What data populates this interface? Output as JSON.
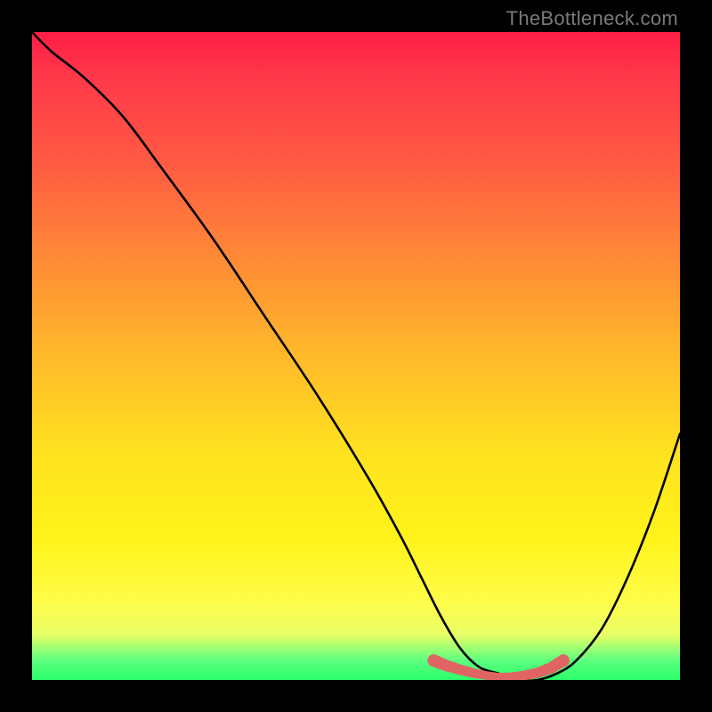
{
  "watermark": "TheBottleneck.com",
  "chart_data": {
    "type": "line",
    "title": "",
    "xlabel": "",
    "ylabel": "",
    "x_range": [
      0,
      100
    ],
    "y_range": [
      0,
      100
    ],
    "series": [
      {
        "name": "bottleneck-curve",
        "color": "#000000",
        "x": [
          0,
          3,
          8,
          14,
          20,
          28,
          36,
          44,
          52,
          57,
          60,
          63,
          66,
          69,
          72,
          75,
          78,
          81,
          84,
          88,
          92,
          96,
          100
        ],
        "values": [
          100,
          97,
          93,
          87,
          79,
          68,
          56,
          44,
          31,
          22,
          16,
          10,
          5,
          2,
          1,
          0,
          0,
          1,
          3,
          8,
          16,
          26,
          38
        ]
      },
      {
        "name": "valley-highlight",
        "color": "#e16464",
        "style": "dotted-thick",
        "x": [
          62,
          64,
          66,
          68,
          70,
          72,
          74,
          76,
          78,
          80,
          82
        ],
        "values": [
          3,
          2.2,
          1.6,
          1.1,
          0.7,
          0.5,
          0.5,
          0.7,
          1.1,
          1.8,
          3
        ]
      }
    ],
    "colors": {
      "gradient_top": "#ff1e46",
      "gradient_bottom": "#2bff6a",
      "background": "#000000"
    }
  }
}
